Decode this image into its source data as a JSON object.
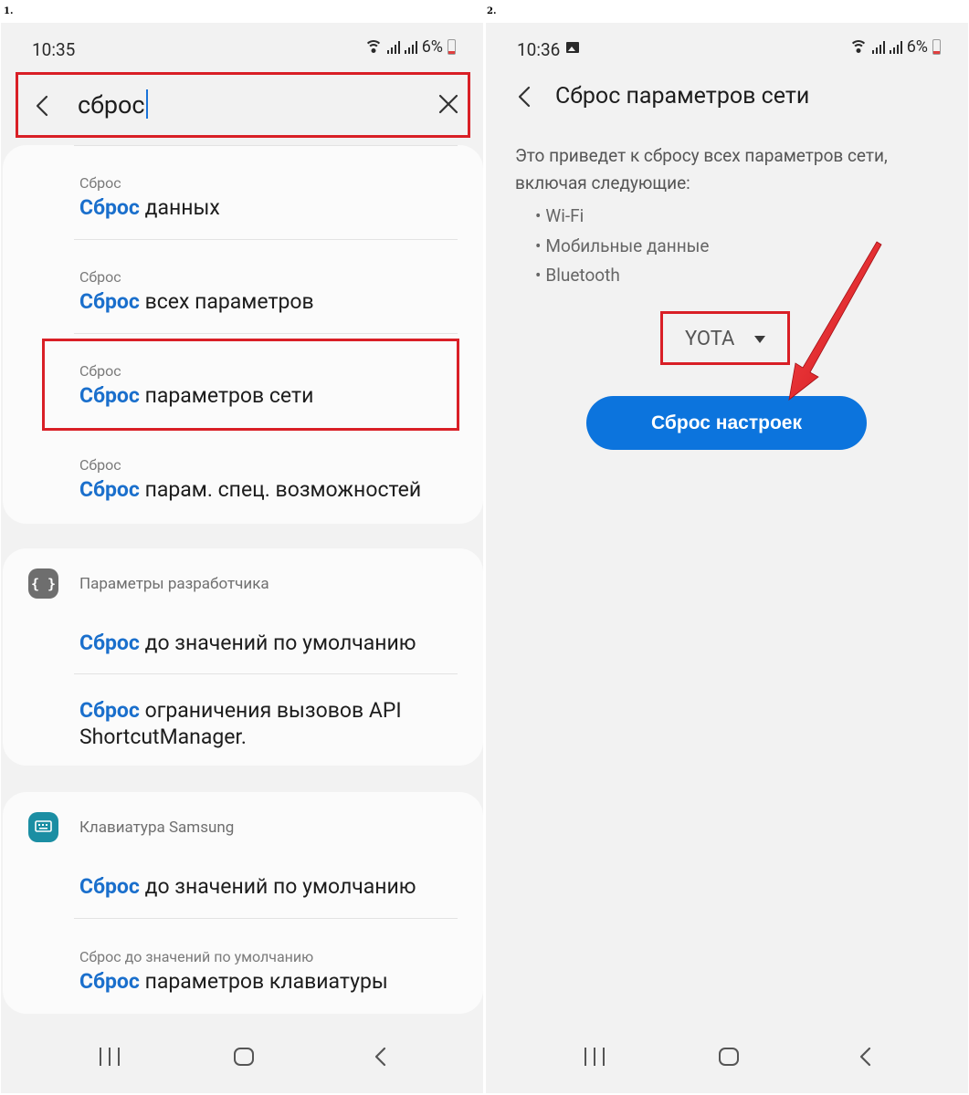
{
  "steps": {
    "step1": "1.",
    "step2": "2."
  },
  "phone1": {
    "status": {
      "time": "10:35",
      "battery": "6%"
    },
    "search": {
      "query": "сброс"
    },
    "results_card": [
      {
        "sub": "Сброс",
        "highlight": "Сброс",
        "rest": " данных"
      },
      {
        "sub": "Сброс",
        "highlight": "Сброс",
        "rest": " всех параметров"
      },
      {
        "sub": "Сброс",
        "highlight": "Сброс",
        "rest": " параметров сети"
      },
      {
        "sub": "Сброс",
        "highlight": "Сброс",
        "rest": " парам. спец. возможностей"
      }
    ],
    "developer_card": {
      "category": "Параметры разработчика",
      "items": [
        {
          "highlight": "Сброс",
          "rest": " до значений по умолчанию"
        },
        {
          "highlight": "Сброс",
          "rest": " ограничения вызовов API",
          "line2": "ShortcutManager."
        }
      ]
    },
    "keyboard_card": {
      "category": "Клавиатура Samsung",
      "items": [
        {
          "highlight": "Сброс",
          "rest": " до значений по умолчанию"
        },
        {
          "sub": "Сброс до значений по умолчанию",
          "highlight": "Сброс",
          "rest": " параметров клавиатуры"
        }
      ]
    }
  },
  "phone2": {
    "status": {
      "time": "10:36",
      "battery": "6%"
    },
    "title": "Сброс параметров сети",
    "description": "Это приведет к сбросу всех параметров сети, включая следующие:",
    "bullets": [
      "Wi-Fi",
      "Мобильные данные",
      "Bluetooth"
    ],
    "sim_selector": "YOTA",
    "reset_button": "Сброс настроек"
  },
  "colors": {
    "accent_blue": "#1a6fcc",
    "button_blue": "#0c74dd",
    "annotation_red": "#d91f26",
    "dev_icon_bg": "#6e6e6e",
    "keyboard_icon_bg": "#1b8ea3"
  },
  "icons": [
    "back-icon",
    "close-icon",
    "wifi-icon",
    "signal-icon",
    "battery-icon",
    "gallery-icon",
    "developer-options-icon",
    "samsung-keyboard-icon",
    "recent-apps-icon",
    "home-icon",
    "nav-back-icon",
    "dropdown-triangle-icon"
  ]
}
